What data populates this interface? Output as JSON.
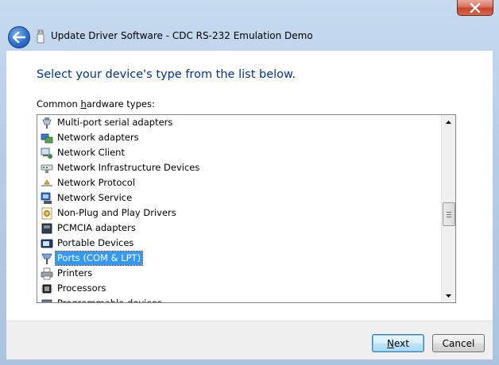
{
  "window": {
    "title": "Update Driver Software - CDC RS-232 Emulation Demo"
  },
  "main": {
    "heading": "Select your device's type from the list below.",
    "list_label_pre": "Common ",
    "list_label_accel": "h",
    "list_label_post": "ardware types:"
  },
  "hardware_types": [
    {
      "label": "Multi-port serial adapters",
      "icon": "serial-adapter-icon",
      "selected": false
    },
    {
      "label": "Network adapters",
      "icon": "network-adapter-icon",
      "selected": false
    },
    {
      "label": "Network Client",
      "icon": "network-client-icon",
      "selected": false
    },
    {
      "label": "Network Infrastructure Devices",
      "icon": "network-infrastructure-icon",
      "selected": false
    },
    {
      "label": "Network Protocol",
      "icon": "network-protocol-icon",
      "selected": false
    },
    {
      "label": "Network Service",
      "icon": "network-service-icon",
      "selected": false
    },
    {
      "label": "Non-Plug and Play Drivers",
      "icon": "non-pnp-driver-icon",
      "selected": false
    },
    {
      "label": "PCMCIA adapters",
      "icon": "pcmcia-icon",
      "selected": false
    },
    {
      "label": "Portable Devices",
      "icon": "portable-device-icon",
      "selected": false
    },
    {
      "label": "Ports (COM & LPT)",
      "icon": "port-connector-icon",
      "selected": true
    },
    {
      "label": "Printers",
      "icon": "printer-icon",
      "selected": false
    },
    {
      "label": "Processors",
      "icon": "processor-icon",
      "selected": false
    },
    {
      "label": "Programmable devices",
      "icon": "programmable-device-icon",
      "selected": false
    }
  ],
  "footer": {
    "next_accel": "N",
    "next_rest": "ext",
    "cancel_label": "Cancel"
  },
  "colors": {
    "heading": "#003399",
    "selection": "#3399ff",
    "close_button": "#c7432a"
  }
}
